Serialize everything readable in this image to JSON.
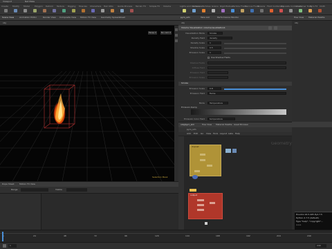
{
  "menubar": {
    "tabs": [
      "Viewport",
      "Net Make"
    ]
  },
  "shelf": {
    "tabs": [
      "Create",
      "Modify",
      "Model",
      "Polygon",
      "Deform",
      "Texture",
      "Rigging",
      "Muscles",
      "Characters",
      "Hair Utils",
      "Guide Process",
      "Terrain FX",
      "Simple FX",
      "Volume"
    ],
    "right_tabs": [
      "Lights and Cameras",
      "Collisions",
      "Particles",
      "Grains",
      "Rigid Bodies",
      "Particle Fluids",
      "Viscous Fluids",
      "Oceans",
      "Fluid Containers",
      "Populate Containers",
      "Container Tools",
      "Pyro FX",
      "Cloth",
      "Solid",
      "Wires",
      "Crowds",
      "Drive Simulation"
    ]
  },
  "viewport": {
    "tabs": [
      "Scene View",
      "Animation Editor",
      "Render View",
      "Composite View",
      "Motion FX View",
      "Geometry Spreadsheet"
    ],
    "path": "obj",
    "persp_label": "Persp ▾",
    "cam_label": "No cam ▾",
    "corner_label": "Geometry",
    "status_label": "Selection Mask"
  },
  "params": {
    "tabs": [
      "pyro_sim",
      "Take List",
      "Performance Monitor"
    ],
    "path": "obj",
    "node_title": "Volume Visualization  volumevisualization1",
    "rows": [
      {
        "label": "Visualization Mode",
        "value": "Smoke"
      },
      {
        "label": "Density Field",
        "value": "density"
      },
      {
        "label": "Density Scale",
        "value": "1"
      },
      {
        "label": "Shadow Scale",
        "value": "0.5"
      },
      {
        "label": "Emission Scale",
        "value": "1"
      },
      {
        "label": "Use Shadow Fields",
        "value": ""
      },
      {
        "label": "Shadow Fields",
        "value": ""
      },
      {
        "label": "Diffuse Field",
        "value": ""
      },
      {
        "label": "Emission Field",
        "value": ""
      },
      {
        "label": "Emission Scale",
        "value": ""
      }
    ],
    "section2": "Smoke",
    "section2_rows": [
      {
        "label": "Emission Scale",
        "value": "0.8"
      },
      {
        "label": "Emission Field",
        "value": "flame"
      },
      {
        "label": "",
        "value": ""
      },
      {
        "label": "Mode",
        "value": "Temperature"
      }
    ],
    "ramp_label": "Emission Ramp",
    "bottom_label": "Emission Color Field",
    "bottom_value": "temperature"
  },
  "right_col": {
    "tabs": [
      "Tree View",
      "Material Palette"
    ],
    "path": "obj"
  },
  "network": {
    "tabs": [
      "/obj/pyro_sim",
      "Tree View",
      "Material Palette",
      "Asset Browser"
    ],
    "path": "pyro_sim",
    "menus": [
      "Add",
      "Edit",
      "Go",
      "View",
      "Tools",
      "Layout",
      "Labs",
      "Help"
    ],
    "label": "Geometry",
    "node1_label": "dopnet",
    "node2_label": "output"
  },
  "tl": {
    "tabs": [
      "Dope Sheet",
      "Motion FX View"
    ],
    "field_label": "Range",
    "field2": "Visible"
  },
  "timeline": {
    "ticks": [
      "1",
      "24",
      "48",
      "72",
      "96",
      "120",
      "144",
      "168",
      "192",
      "216",
      "240"
    ],
    "frame": "1",
    "end": "240"
  },
  "console": {
    "lines": [
      "Houdini 16.5.405 Py2.7.5",
      "Python 2.7.5 (default)",
      "Type \"help\", \"copyright\"...",
      ">>>"
    ]
  },
  "colors": {
    "node_yellow": "#c9a63a",
    "node_red": "#c0392b",
    "fire": "#ff8c1a",
    "accent_blue": "#4a90d9"
  }
}
